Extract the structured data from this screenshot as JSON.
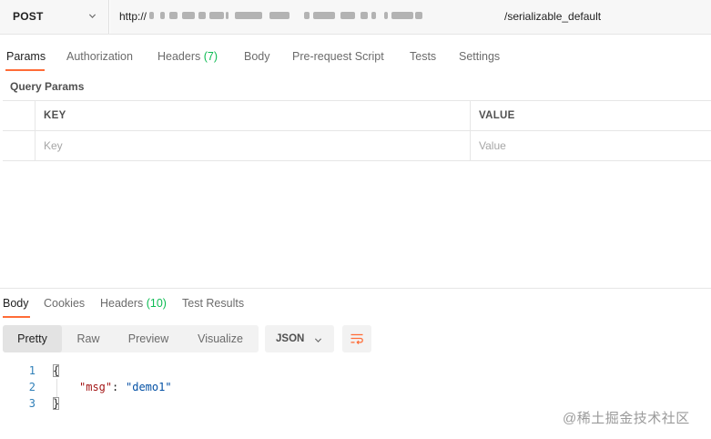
{
  "request": {
    "method": "POST",
    "url_prefix": "http://",
    "url_suffix": "/serializable_default"
  },
  "request_tabs": [
    {
      "label": "Params",
      "active": true
    },
    {
      "label": "Authorization"
    },
    {
      "label": "Headers",
      "count": "(7)"
    },
    {
      "label": "Body"
    },
    {
      "label": "Pre-request Script"
    },
    {
      "label": "Tests"
    },
    {
      "label": "Settings"
    }
  ],
  "query_params": {
    "title": "Query Params",
    "columns": {
      "key": "KEY",
      "value": "VALUE"
    },
    "placeholders": {
      "key": "Key",
      "value": "Value"
    }
  },
  "response_tabs": [
    {
      "label": "Body",
      "active": true
    },
    {
      "label": "Cookies"
    },
    {
      "label": "Headers",
      "count": "(10)"
    },
    {
      "label": "Test Results"
    }
  ],
  "view_modes": [
    "Pretty",
    "Raw",
    "Preview",
    "Visualize"
  ],
  "active_view": "Pretty",
  "format": "JSON",
  "code": {
    "line_numbers": [
      "1",
      "2",
      "3"
    ],
    "open_brace": "{",
    "key": "\"msg\"",
    "colon": ": ",
    "value": "\"demo1\"",
    "close_brace": "}"
  },
  "watermark": "@稀土掘金技术社区",
  "icons": {
    "method_chevron": "chevron-down-icon",
    "format_chevron": "chevron-down-icon",
    "wrap": "wrap-lines-icon"
  },
  "colors": {
    "accent": "#ff6c37",
    "count_green": "#0cbb52",
    "line_number": "#2f7fb8",
    "json_key": "#a31515",
    "json_string": "#0451a5"
  }
}
